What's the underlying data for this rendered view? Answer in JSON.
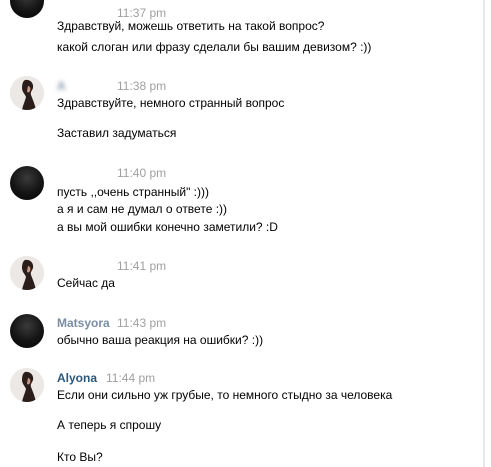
{
  "messages": [
    {
      "author": "",
      "time": "11:37 pm",
      "lines": [
        "Здравствуй, можешь ответить на такой вопрос?",
        "какой слоган или фразу сделали бы вашим девизом? :))"
      ]
    },
    {
      "author": "A",
      "time": "11:38 pm",
      "lines": [
        "Здравствуйте, немного странный вопрос",
        "Заставил задуматься"
      ]
    },
    {
      "author": "",
      "time": "11:40 pm",
      "lines": [
        "пусть ,,очень странный\" :)))",
        "а я и сам не думал о ответе :))",
        "а вы мой ошибки конечно заметили? :D"
      ]
    },
    {
      "author": "",
      "time": "11:41 pm",
      "lines": [
        "Сейчас да"
      ]
    },
    {
      "author": "Matsyora",
      "time": "11:43 pm",
      "lines": [
        "обычно ваша реакция на ошибки? :))"
      ]
    },
    {
      "author": "Alyona",
      "time": "11:44 pm",
      "lines": [
        "Если они сильно уж грубые, то немного стыдно за человека",
        "А теперь я спрошу",
        "Кто Вы?"
      ]
    }
  ],
  "icons": {
    "dark_avatar": "dark-avatar-photo",
    "light_avatar": "woman-profile-photo"
  }
}
